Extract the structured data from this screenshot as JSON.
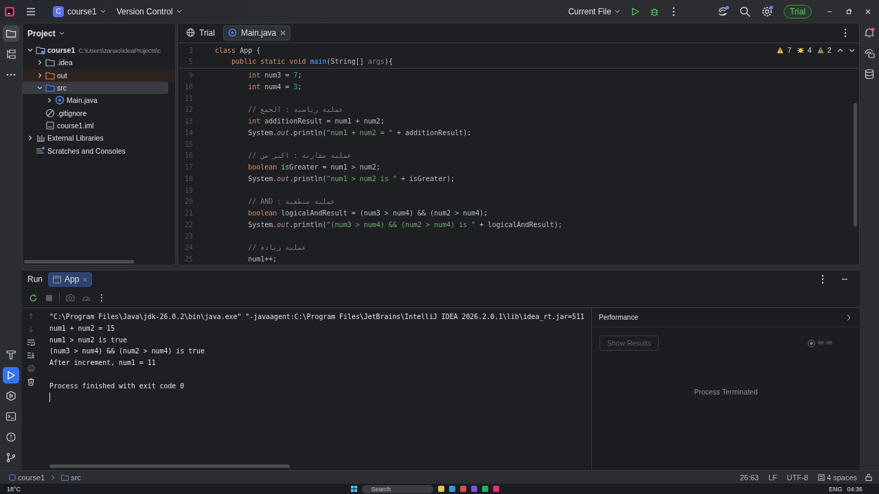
{
  "title_bar": {
    "project_initial": "C",
    "project": "course1",
    "vcs": "Version Control",
    "run_config": "Current File",
    "trial": "Trial",
    "actions": [
      {
        "kind": "ai",
        "dot": true
      },
      {
        "kind": "search",
        "dot": false
      },
      {
        "kind": "settings",
        "dot": true
      }
    ]
  },
  "left_tools": {
    "top": [
      {
        "kind": "project",
        "selected": true
      },
      {
        "kind": "structure",
        "selected": false
      },
      {
        "kind": "more",
        "selected": false
      }
    ],
    "bottom": [
      {
        "kind": "build",
        "selected": false
      },
      {
        "kind": "run",
        "selected": true
      },
      {
        "kind": "services",
        "selected": false
      },
      {
        "kind": "terminal",
        "selected": false
      },
      {
        "kind": "problems",
        "selected": false
      },
      {
        "kind": "git",
        "selected": false
      }
    ]
  },
  "right_tools": [
    {
      "kind": "notifications",
      "dot": true
    },
    {
      "kind": "ai-chat",
      "dot": false
    },
    {
      "kind": "database",
      "dot": false
    }
  ],
  "project_panel": {
    "title": "Project",
    "tree": [
      {
        "name": "course1",
        "path": "C:\\Users\\zanao\\IdeaProjects\\c",
        "kind": "module",
        "expanded": true,
        "selected": false,
        "children": [
          {
            "name": ".idea",
            "kind": "folder",
            "expanded": false,
            "selected": false
          },
          {
            "name": "out",
            "kind": "excluded-folder",
            "expanded": false,
            "selected": false
          },
          {
            "name": "src",
            "kind": "source-folder",
            "expanded": true,
            "selected": true,
            "children": [
              {
                "name": "Main.java",
                "kind": "java-class",
                "expanded": false,
                "selected": false
              }
            ]
          },
          {
            "name": ".gitignore",
            "kind": "ignore",
            "selected": false
          },
          {
            "name": "course1.iml",
            "kind": "iml",
            "selected": false
          }
        ]
      },
      {
        "name": "External Libraries",
        "kind": "libraries",
        "expanded": false,
        "selected": false
      },
      {
        "name": "Scratches and Consoles",
        "kind": "scratches",
        "selected": false
      }
    ]
  },
  "editor": {
    "tabs": [
      {
        "label": "Trial",
        "kind": "web",
        "selected": false
      },
      {
        "label": "Main.java",
        "kind": "java",
        "selected": true
      }
    ],
    "inspections": [
      {
        "kind": "warning",
        "count": "7"
      },
      {
        "kind": "bug",
        "count": "4"
      },
      {
        "kind": "weak-warning",
        "count": "2"
      }
    ],
    "sticky_lines": [
      {
        "number": "3",
        "tokens": [
          {
            "kind": "keyword",
            "text": "class "
          },
          {
            "kind": "plain",
            "text": "App {"
          }
        ],
        "children": [
          {
            "number": "5",
            "tokens": [
              {
                "kind": "keyword",
                "text": "public static void "
              },
              {
                "kind": "function",
                "text": "main"
              },
              {
                "kind": "plain",
                "text": "(String[] "
              },
              {
                "kind": "unused",
                "text": "args"
              },
              {
                "kind": "plain",
                "text": "){"
              }
            ]
          }
        ]
      }
    ],
    "lines": [
      {
        "number": "9",
        "tokens": [
          {
            "kind": "keyword",
            "text": "int "
          },
          {
            "kind": "plain",
            "text": "num3 = "
          },
          {
            "kind": "number",
            "text": "7"
          },
          {
            "kind": "plain",
            "text": ";"
          }
        ]
      },
      {
        "number": "10",
        "tokens": [
          {
            "kind": "keyword",
            "text": "int "
          },
          {
            "kind": "plain",
            "text": "num4 = "
          },
          {
            "kind": "number",
            "text": "3"
          },
          {
            "kind": "plain",
            "text": ";"
          }
        ]
      },
      {
        "number": "11"
      },
      {
        "number": "12",
        "tokens": [
          {
            "kind": "comment",
            "text": "// عملية رياضية : الجمع"
          }
        ]
      },
      {
        "number": "13",
        "tokens": [
          {
            "kind": "keyword",
            "text": "int "
          },
          {
            "kind": "plain",
            "text": "additionResult = num1 + num2;"
          }
        ]
      },
      {
        "number": "14",
        "tokens": [
          {
            "kind": "plain",
            "text": "System."
          },
          {
            "kind": "field",
            "text": "out"
          },
          {
            "kind": "plain",
            "text": ".println("
          },
          {
            "kind": "string",
            "text": "\"num1 + num2 = \""
          },
          {
            "kind": "plain",
            "text": " + additionResult);"
          }
        ]
      },
      {
        "number": "15"
      },
      {
        "number": "16",
        "tokens": [
          {
            "kind": "comment",
            "text": "// عملية مقارنة : اكبر من"
          }
        ]
      },
      {
        "number": "17",
        "tokens": [
          {
            "kind": "keyword",
            "text": "boolean "
          },
          {
            "kind": "plain",
            "text": "isGreater = num1 > num2;"
          }
        ]
      },
      {
        "number": "18",
        "tokens": [
          {
            "kind": "plain",
            "text": "System."
          },
          {
            "kind": "field",
            "text": "out"
          },
          {
            "kind": "plain",
            "text": ".println("
          },
          {
            "kind": "string",
            "text": "\"num1 > num2 is \""
          },
          {
            "kind": "plain",
            "text": " + isGreater);"
          }
        ]
      },
      {
        "number": "19"
      },
      {
        "number": "20",
        "tokens": [
          {
            "kind": "comment",
            "text": "// AND : عملية منطقية"
          }
        ]
      },
      {
        "number": "21",
        "tokens": [
          {
            "kind": "keyword",
            "text": "boolean "
          },
          {
            "kind": "plain",
            "text": "logicalAndResult = (num3 > num4) && (num2 > num4);"
          }
        ]
      },
      {
        "number": "22",
        "tokens": [
          {
            "kind": "plain",
            "text": "System."
          },
          {
            "kind": "field",
            "text": "out"
          },
          {
            "kind": "plain",
            "text": ".println("
          },
          {
            "kind": "string",
            "text": "\"(num3 > num4) && (num2 > num4) is \""
          },
          {
            "kind": "plain",
            "text": " + logicalAndResult);"
          }
        ]
      },
      {
        "number": "23"
      },
      {
        "number": "24",
        "tokens": [
          {
            "kind": "comment",
            "text": "// عملية زيادة"
          }
        ]
      },
      {
        "number": "25",
        "tokens": [
          {
            "kind": "plain",
            "text": "num1++;"
          }
        ]
      }
    ]
  },
  "run_panel": {
    "title": "Run",
    "tabs": [
      {
        "label": "App",
        "selected": true
      }
    ],
    "console": [
      {
        "kind": "command",
        "text": "\"C:\\Program Files\\Java\\jdk-26.0.2\\bin\\java.exe\" \"-javaagent:C:\\Program Files\\JetBrains\\IntelliJ IDEA 2026.2.0.1\\lib\\idea_rt.jar=511"
      },
      {
        "kind": "output",
        "text": "num1 + num2 = 15"
      },
      {
        "kind": "output",
        "text": "num1 > num2 is true"
      },
      {
        "kind": "output",
        "text": "(num3 > num4) && (num2 > num4) is true"
      },
      {
        "kind": "output",
        "text": "After increment, num1 = 11"
      },
      {
        "kind": "exit",
        "text": "Process finished with exit code 0"
      }
    ],
    "performance": {
      "title": "Performance",
      "button": "Show Results",
      "button_disabled": true,
      "timer": "00:00",
      "status": "Process Terminated"
    }
  },
  "status_bar": {
    "breadcrumbs": [
      "course1",
      "src"
    ],
    "items": [
      "26:63",
      "LF",
      "UTF-8",
      "4 spaces"
    ]
  },
  "taskbar": {
    "weather": "18°C",
    "search": "Search",
    "language": "ENG",
    "time": "04:36"
  }
}
